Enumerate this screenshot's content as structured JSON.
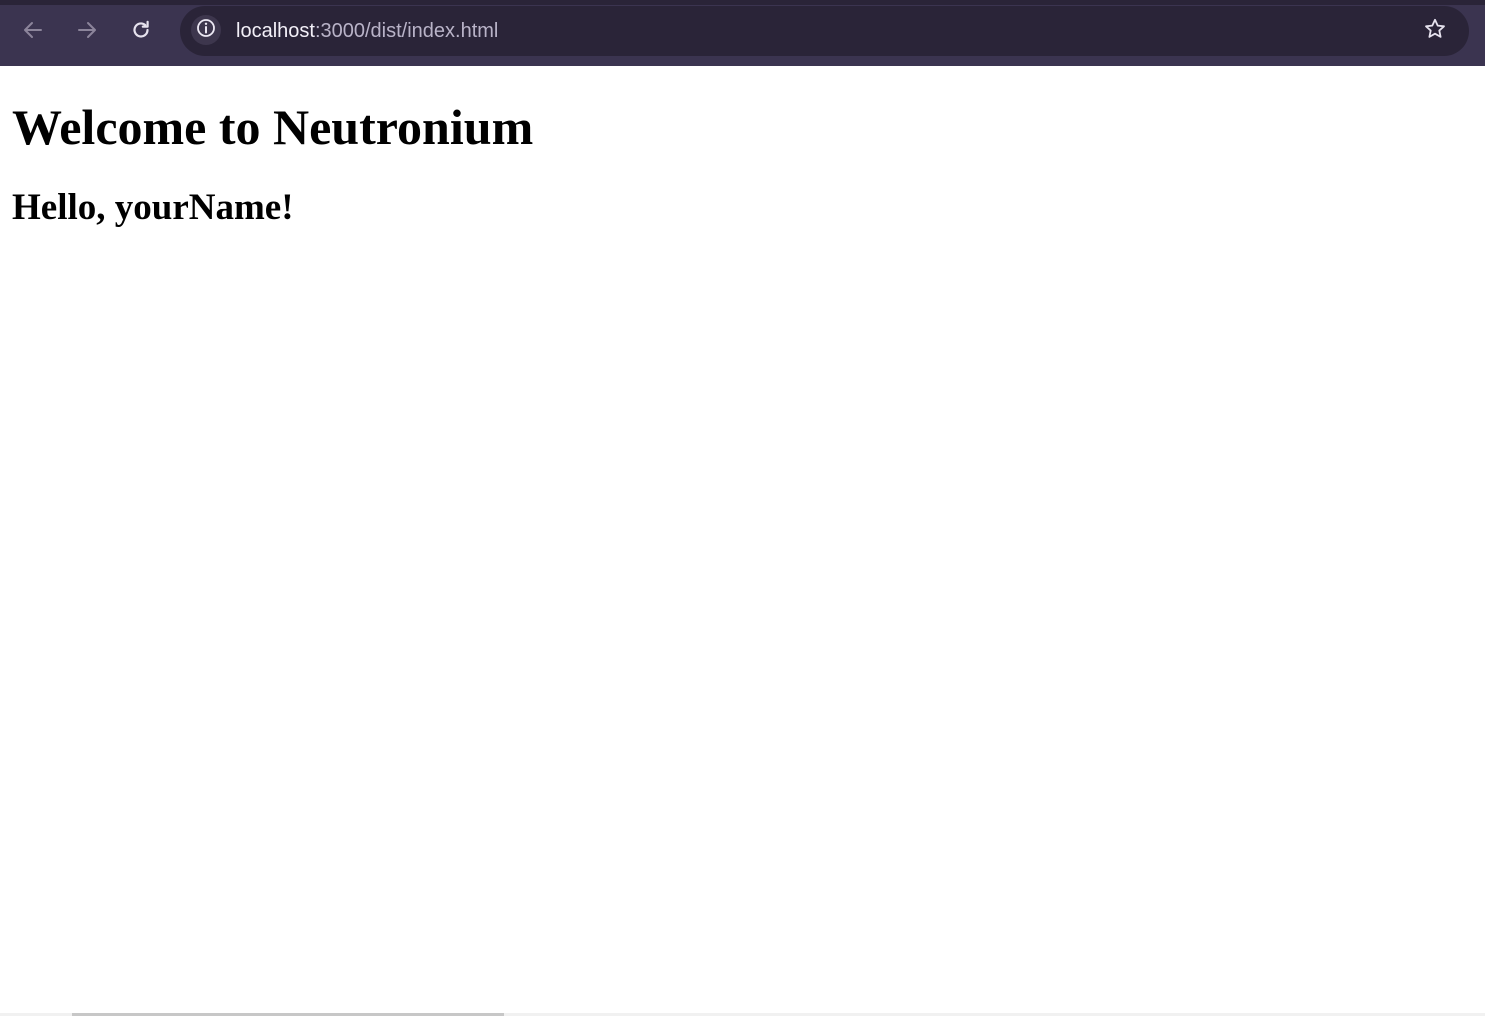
{
  "browser": {
    "url_host": "localhost",
    "url_path": ":3000/dist/index.html",
    "icons": {
      "back": "back-arrow-icon",
      "forward": "forward-arrow-icon",
      "reload": "reload-icon",
      "site_info": "info-icon",
      "bookmark": "star-icon"
    },
    "colors": {
      "toolbar": "#3b3450",
      "address_bar": "#2a2438",
      "url_text": "#e9e5f2"
    }
  },
  "page": {
    "heading": "Welcome to Neutronium",
    "greeting": "Hello, yourName!"
  }
}
